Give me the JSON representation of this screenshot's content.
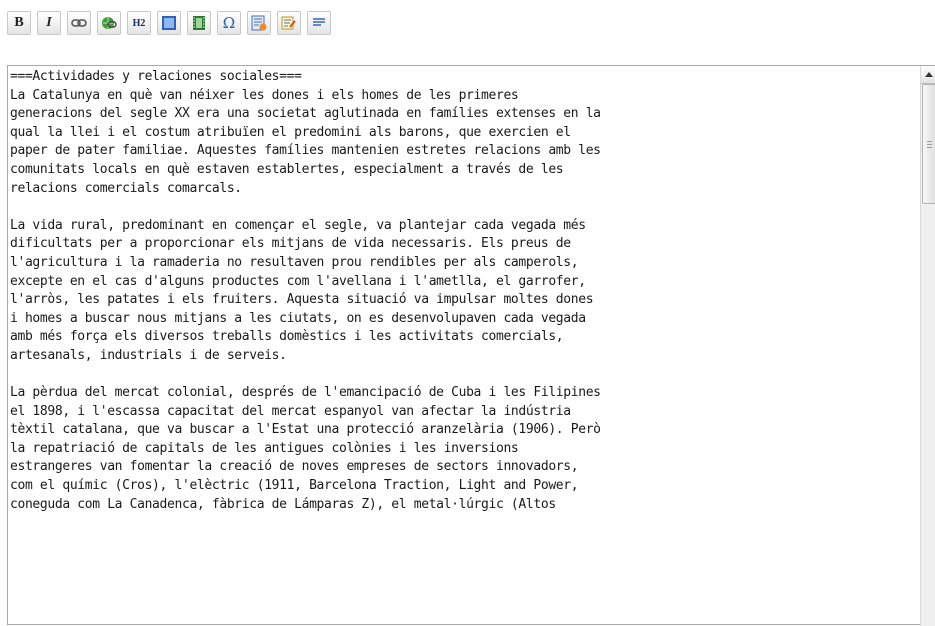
{
  "toolbar": {
    "buttons": [
      {
        "name": "bold-button",
        "label": "B"
      },
      {
        "name": "italic-button",
        "label": "I"
      },
      {
        "name": "link-icon"
      },
      {
        "name": "external-link-icon"
      },
      {
        "name": "h2-button",
        "label": "H2"
      },
      {
        "name": "image-icon"
      },
      {
        "name": "media-icon"
      },
      {
        "name": "special-chars-icon",
        "label": "Ω"
      },
      {
        "name": "template-icon"
      },
      {
        "name": "signature-icon"
      },
      {
        "name": "line-icon"
      }
    ]
  },
  "editor": {
    "lines": [
      "===Actividades y relaciones sociales===",
      "La Catalunya en què van néixer les dones i els homes de les primeres",
      "generacions del segle XX era una societat aglutinada en famílies extenses en la",
      "qual la llei i el costum atribuïen el predomini als barons, que exercien el",
      "paper de pater familiae. Aquestes famílies mantenien estretes relacions amb les",
      "comunitats locals en què estaven establertes, especialment a través de les",
      "relacions comercials comarcals.",
      "",
      "La vida rural, predominant en començar el segle, va plantejar cada vegada més",
      "dificultats per a proporcionar els mitjans de vida necessaris. Els preus de",
      "l'agricultura i la ramaderia no resultaven prou rendibles per als camperols,",
      "excepte en el cas d'alguns productes com l'avellana i l'ametlla, el garrofer,",
      "l'arròs, les patates i els fruiters. Aquesta situació va impulsar moltes dones",
      "i homes a buscar nous mitjans a les ciutats, on es desenvolupaven cada vegada",
      "amb més força els diversos treballs domèstics i les activitats comercials,",
      "artesanals, industrials i de serveis.",
      "",
      "La pèrdua del mercat colonial, després de l'emancipació de Cuba i les Filipines",
      "el 1898, i l'escassa capacitat del mercat espanyol van afectar la indústria",
      "tèxtil catalana, que va buscar a l'Estat una protecció aranzelària (1906). Però",
      "la repatriació de capitals de les antigues colònies i les inversions",
      "estrangeres van fomentar la creació de noves empreses de sectors innovadors,",
      "com el químic (Cros), l'elèctric (1911, Barcelona Traction, Light and Power,",
      "coneguda com La Canadenca, fàbrica de Lámparas Z), el metal·lúrgic (Altos"
    ]
  }
}
